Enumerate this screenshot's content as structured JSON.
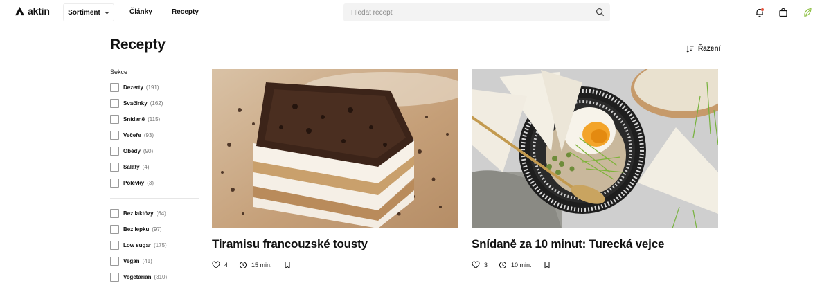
{
  "header": {
    "logo_text": "aktin",
    "nav": {
      "sortiment": "Sortiment",
      "clanky": "Články",
      "recepty": "Recepty"
    },
    "search_placeholder": "Hledat recept"
  },
  "main": {
    "title": "Recepty",
    "sort_label": "Řazení"
  },
  "filters": {
    "section_title": "Sekce",
    "groups": [
      {
        "name": "Dezerty",
        "count": "(191)"
      },
      {
        "name": "Svačinky",
        "count": "(162)"
      },
      {
        "name": "Snídaně",
        "count": "(115)"
      },
      {
        "name": "Večeře",
        "count": "(93)"
      },
      {
        "name": "Obědy",
        "count": "(90)"
      },
      {
        "name": "Saláty",
        "count": "(4)"
      },
      {
        "name": "Polévky",
        "count": "(3)"
      }
    ],
    "diet": [
      {
        "name": "Bez laktózy",
        "count": "(64)"
      },
      {
        "name": "Bez lepku",
        "count": "(97)"
      },
      {
        "name": "Low sugar",
        "count": "(175)"
      },
      {
        "name": "Vegan",
        "count": "(41)"
      },
      {
        "name": "Vegetarian",
        "count": "(310)"
      }
    ]
  },
  "recipes": [
    {
      "title": "Tiramisu francouzské tousty",
      "likes": "4",
      "time": "15 min."
    },
    {
      "title": "Snídaně za 10 minut: Turecká vejce",
      "likes": "3",
      "time": "10 min."
    }
  ],
  "colors": {
    "text": "#111111",
    "muted": "#777777",
    "search_bg": "#f3f3f3",
    "accent_leaf": "#8bbf3f"
  }
}
